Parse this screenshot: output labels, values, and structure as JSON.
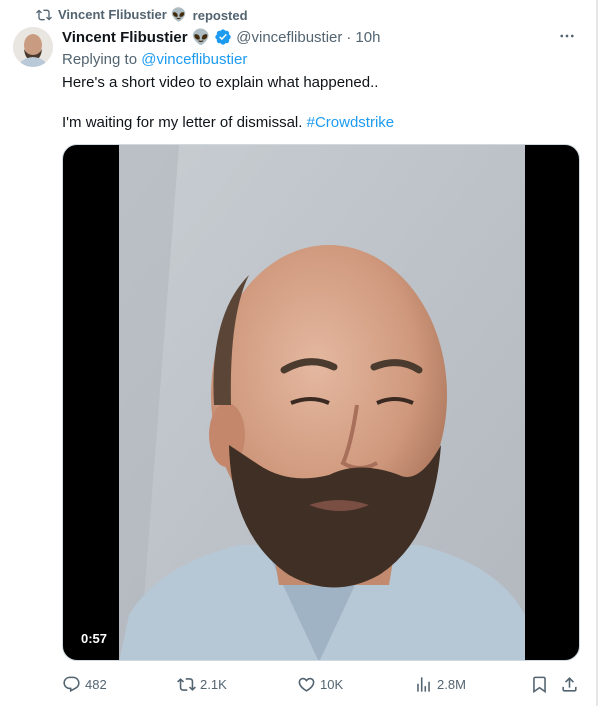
{
  "repost_banner": {
    "name": "Vincent Flibustier",
    "emoji": "👽",
    "label": "reposted"
  },
  "tweet": {
    "author": {
      "display_name": "Vincent Flibustier",
      "emoji": "👽",
      "handle": "@vinceflibustier",
      "time": "10h"
    },
    "replying_prefix": "Replying to",
    "replying_to": "@vinceflibustier",
    "line1": "Here's a short video to explain what happened..",
    "line2_text": "I'm waiting for my letter of dismissal.",
    "hashtag": "#Crowdstrike",
    "video": {
      "duration": "0:57"
    }
  },
  "actions": {
    "replies": "482",
    "reposts": "2.1K",
    "likes": "10K",
    "views": "2.8M"
  },
  "colors": {
    "accent": "#1d9bf0",
    "muted": "#536471",
    "text": "#0f1419"
  }
}
